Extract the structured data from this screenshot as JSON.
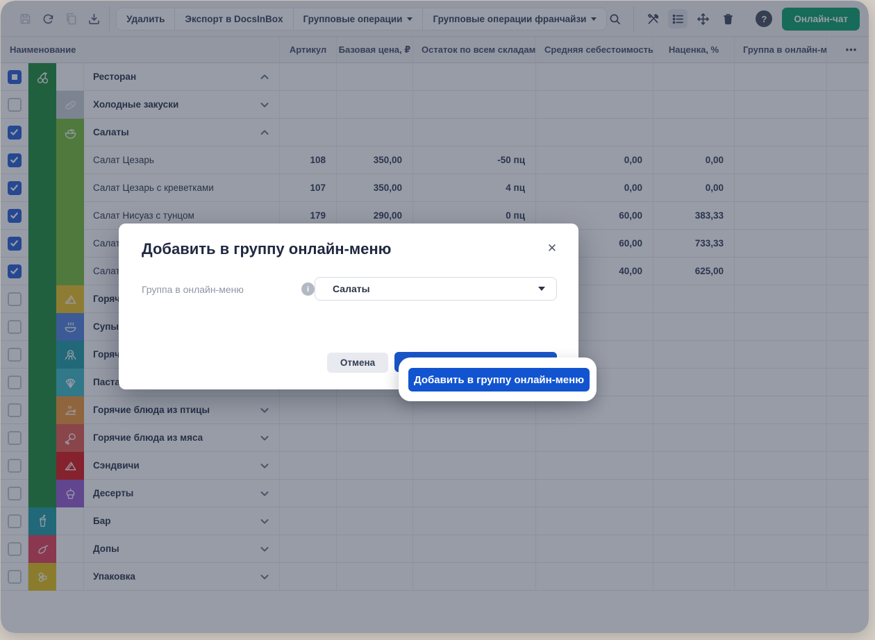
{
  "toolbar": {
    "icon_buttons_left": [
      {
        "icon": "save-icon",
        "disabled": true
      },
      {
        "icon": "refresh-icon",
        "disabled": false
      },
      {
        "icon": "copy-icon",
        "disabled": true
      },
      {
        "icon": "import-icon",
        "disabled": false
      }
    ],
    "action_buttons": [
      {
        "label": "Удалить",
        "dropdown": false
      },
      {
        "label": "Экспорт в DocsInBox",
        "dropdown": false
      },
      {
        "label": "Групповые операции",
        "dropdown": true
      },
      {
        "label": "Групповые операции франчайзи",
        "dropdown": true
      }
    ],
    "icon_buttons_right": [
      {
        "icon": "search-icon",
        "active": false,
        "separator_after": true
      },
      {
        "icon": "tools-icon",
        "active": false
      },
      {
        "icon": "list-view-icon",
        "active": true
      },
      {
        "icon": "move-icon",
        "active": false
      },
      {
        "icon": "trash-icon",
        "active": false
      }
    ],
    "help_label": "?",
    "chat_button_label": "Онлайн-чат",
    "chat_button_color": "#12a572"
  },
  "table": {
    "columns": [
      {
        "label": "Наименование"
      },
      {
        "label": "Артикул"
      },
      {
        "label": "Базовая цена, ₽"
      },
      {
        "label": "Остаток по всем складам..."
      },
      {
        "label": "Средняя себестоимость..."
      },
      {
        "label": "Наценка, %"
      },
      {
        "label": "Группа в онлайн-меню"
      },
      {
        "label": "•••"
      }
    ],
    "rows": [
      {
        "name": "Ресторан",
        "kind": "group",
        "checkbox": "indeterminate",
        "band1": "#23913f",
        "band1_icon": "cherry-icon",
        "band2": "",
        "chevron": "up",
        "article": "",
        "base_price": "",
        "stock": "",
        "avg_cost": "",
        "markup": ""
      },
      {
        "name": "Холодные закуски",
        "kind": "group",
        "checkbox": "unchecked",
        "band1": "#23913f",
        "band2": "#cdd2d9",
        "band2_icon": "pickle-icon",
        "chevron": "down",
        "article": "",
        "base_price": "",
        "stock": "",
        "avg_cost": "",
        "markup": ""
      },
      {
        "name": "Салаты",
        "kind": "group",
        "checkbox": "checked",
        "band1": "#23913f",
        "band2": "#78bf3e",
        "band2_icon": "salad-bowl-icon",
        "chevron": "up",
        "article": "",
        "base_price": "",
        "stock": "",
        "avg_cost": "",
        "markup": ""
      },
      {
        "name": "Салат Цезарь",
        "kind": "item",
        "checkbox": "checked",
        "band1": "#23913f",
        "band2": "#78bf3e",
        "chevron": "",
        "article": "108",
        "base_price": "350,00",
        "stock": "-50 пц",
        "avg_cost": "0,00",
        "markup": "0,00"
      },
      {
        "name": "Салат Цезарь с креветками",
        "kind": "item",
        "checkbox": "checked",
        "band1": "#23913f",
        "band2": "#78bf3e",
        "chevron": "",
        "article": "107",
        "base_price": "350,00",
        "stock": "4 пц",
        "avg_cost": "0,00",
        "markup": "0,00"
      },
      {
        "name": "Салат Нисуаз с тунцом",
        "kind": "item",
        "checkbox": "checked",
        "band1": "#23913f",
        "band2": "#78bf3e",
        "chevron": "",
        "article": "179",
        "base_price": "290,00",
        "stock": "0 пц",
        "avg_cost": "60,00",
        "markup": "383,33"
      },
      {
        "name": "Салат",
        "kind": "item",
        "checkbox": "checked",
        "band1": "#23913f",
        "band2": "#78bf3e",
        "chevron": "",
        "article": "",
        "base_price": "",
        "stock": "",
        "avg_cost": "60,00",
        "markup": "733,33"
      },
      {
        "name": "Салат",
        "kind": "item",
        "checkbox": "checked",
        "band1": "#23913f",
        "band2": "#78bf3e",
        "chevron": "",
        "article": "",
        "base_price": "",
        "stock": "",
        "avg_cost": "40,00",
        "markup": "625,00"
      },
      {
        "name": "Горяч",
        "kind": "group",
        "checkbox": "unchecked",
        "band1": "#23913f",
        "band2": "#ecc52c",
        "band2_icon": "hot-snack-icon",
        "chevron": "down",
        "article": "",
        "base_price": "",
        "stock": "",
        "avg_cost": "",
        "markup": ""
      },
      {
        "name": "Супы",
        "kind": "group",
        "checkbox": "unchecked",
        "band1": "#23913f",
        "band2": "#5585e0",
        "band2_icon": "soup-icon",
        "chevron": "down",
        "article": "",
        "base_price": "",
        "stock": "",
        "avg_cost": "",
        "markup": ""
      },
      {
        "name": "Горяч",
        "kind": "group",
        "checkbox": "unchecked",
        "band1": "#23913f",
        "band2": "#23a2ad",
        "band2_icon": "octopus-icon",
        "chevron": "down",
        "article": "",
        "base_price": "",
        "stock": "",
        "avg_cost": "",
        "markup": ""
      },
      {
        "name": "Паста",
        "kind": "group",
        "checkbox": "unchecked",
        "band1": "#23913f",
        "band2": "#41bcca",
        "band2_icon": "shell-icon",
        "chevron": "down",
        "article": "",
        "base_price": "",
        "stock": "",
        "avg_cost": "",
        "markup": ""
      },
      {
        "name": "Горячие блюда из птицы",
        "kind": "group",
        "checkbox": "unchecked",
        "band1": "#23913f",
        "band2": "#f09a3e",
        "band2_icon": "poultry-icon",
        "chevron": "down",
        "article": "",
        "base_price": "",
        "stock": "",
        "avg_cost": "",
        "markup": ""
      },
      {
        "name": "Горячие блюда из мяса",
        "kind": "group",
        "checkbox": "unchecked",
        "band1": "#23913f",
        "band2": "#e55f55",
        "band2_icon": "meat-icon",
        "chevron": "down",
        "article": "",
        "base_price": "",
        "stock": "",
        "avg_cost": "",
        "markup": ""
      },
      {
        "name": "Сэндвичи",
        "kind": "group",
        "checkbox": "unchecked",
        "band1": "#23913f",
        "band2": "#dc1e20",
        "band2_icon": "sandwich-icon",
        "chevron": "down",
        "article": "",
        "base_price": "",
        "stock": "",
        "avg_cost": "",
        "markup": ""
      },
      {
        "name": "Десерты",
        "kind": "group",
        "checkbox": "unchecked",
        "band1": "#23913f",
        "band2": "#9c5fd4",
        "band2_icon": "cupcake-icon",
        "chevron": "down",
        "article": "",
        "base_price": "",
        "stock": "",
        "avg_cost": "",
        "markup": ""
      },
      {
        "name": "Бар",
        "kind": "group",
        "checkbox": "unchecked",
        "band1": "#23a2ad",
        "band1_icon": "drink-icon",
        "band2": "",
        "chevron": "down",
        "article": "",
        "base_price": "",
        "stock": "",
        "avg_cost": "",
        "markup": ""
      },
      {
        "name": "Допы",
        "kind": "group",
        "checkbox": "unchecked",
        "band1": "#e84560",
        "band1_icon": "pepper-icon",
        "band2": "",
        "chevron": "down",
        "article": "",
        "base_price": "",
        "stock": "",
        "avg_cost": "",
        "markup": ""
      },
      {
        "name": "Упаковка",
        "kind": "group",
        "checkbox": "unchecked",
        "band1": "#e6c51e",
        "band1_icon": "honeycomb-icon",
        "band2": "",
        "chevron": "down",
        "article": "",
        "base_price": "",
        "stock": "",
        "avg_cost": "",
        "markup": ""
      }
    ]
  },
  "modal": {
    "title": "Добавить в группу онлайн-меню",
    "close_icon": "✕",
    "field_label": "Группа в онлайн-меню",
    "info_icon": "i",
    "select_value": "Салаты",
    "cancel_label": "Отмена",
    "submit_label": "Добавить в группу онлайн-меню"
  },
  "spotlight": {
    "button_label": "Добавить в группу онлайн-меню",
    "button_color": "#1254d0"
  }
}
